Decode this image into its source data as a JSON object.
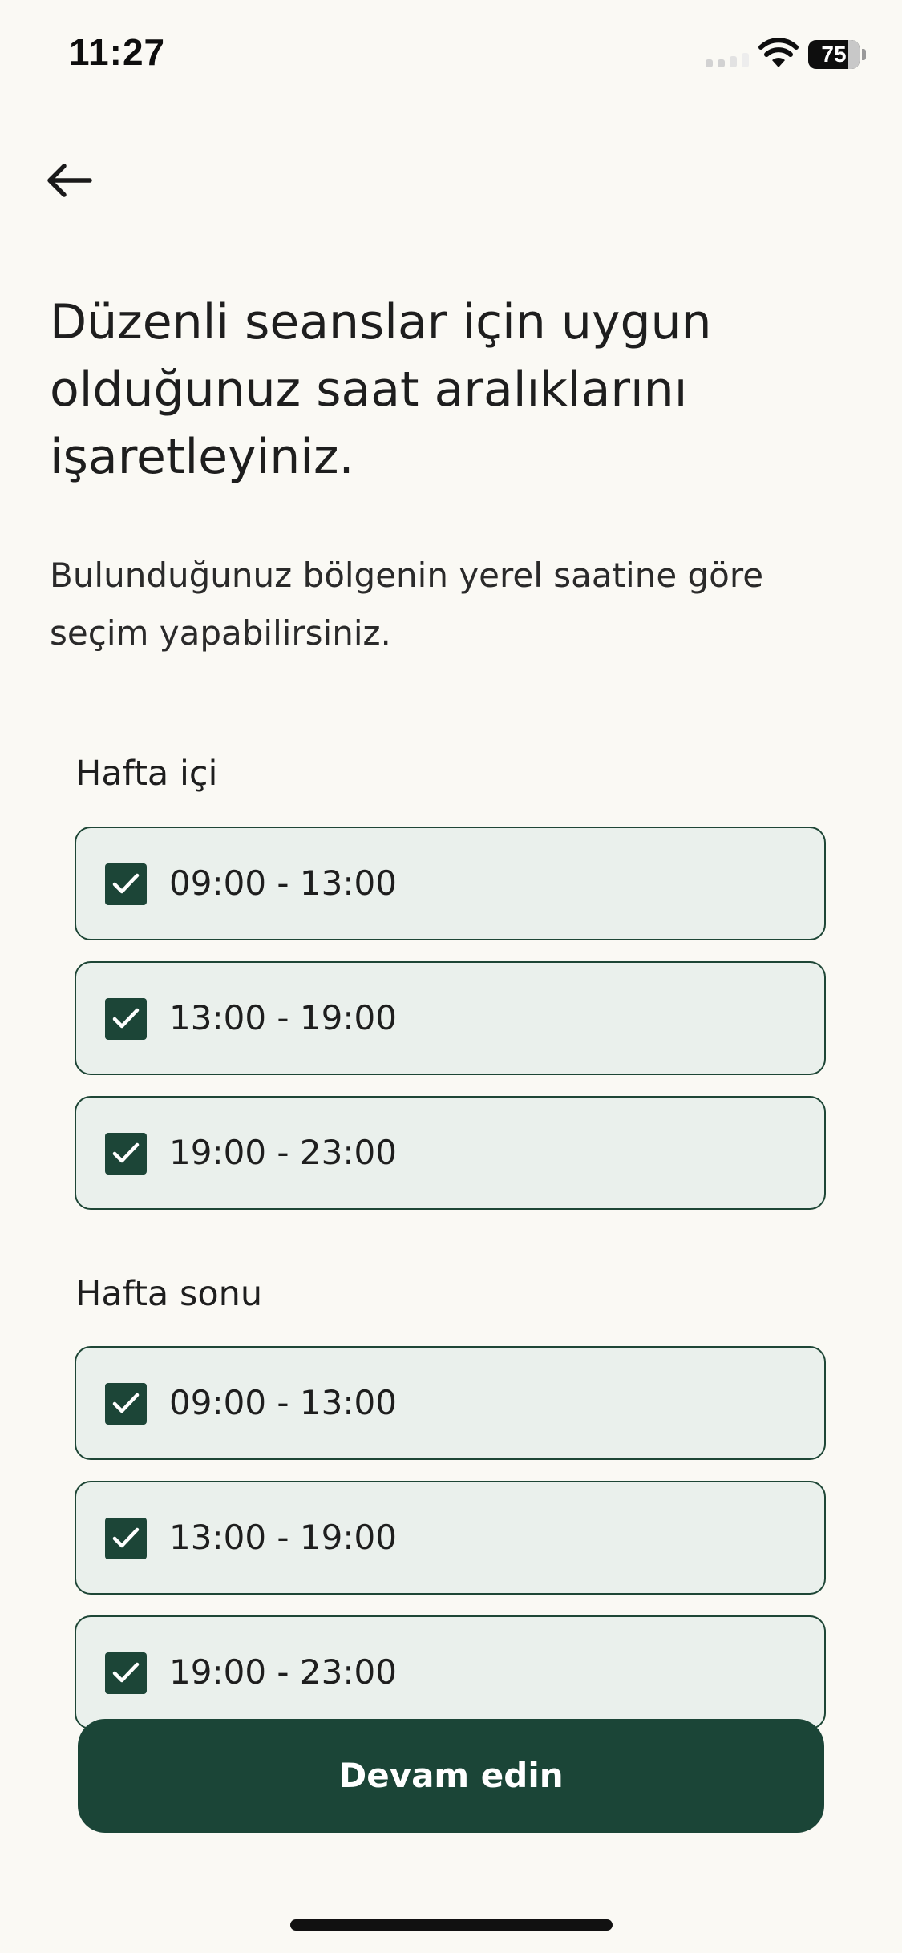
{
  "status_bar": {
    "time": "11:27",
    "battery_level": "75",
    "icons": [
      "signal-icon",
      "wifi-icon",
      "battery-icon"
    ]
  },
  "header": {
    "back_icon": "arrow-left-icon"
  },
  "title": "Düzenli seanslar için uygun olduğunuz saat aralıklarını işaretleyiniz.",
  "subtitle": "Bulunduğunuz bölgenin yerel saatine göre seçim yapabilirsiniz.",
  "weekdays": {
    "label": "Hafta içi",
    "options": [
      {
        "label": "09:00 - 13:00",
        "checked": true
      },
      {
        "label": "13:00 - 19:00",
        "checked": true
      },
      {
        "label": "19:00 - 23:00",
        "checked": true
      }
    ]
  },
  "weekend": {
    "label": "Hafta sonu",
    "options": [
      {
        "label": "09:00 - 13:00",
        "checked": true
      },
      {
        "label": "13:00 - 19:00",
        "checked": true
      },
      {
        "label": "19:00 - 23:00",
        "checked": true
      }
    ]
  },
  "continue_button": {
    "label": "Devam edin"
  },
  "colors": {
    "background": "#FAF9F4",
    "primary": "#1B4537",
    "option_bg": "#EAF0EC",
    "text": "#1E1E1E"
  }
}
